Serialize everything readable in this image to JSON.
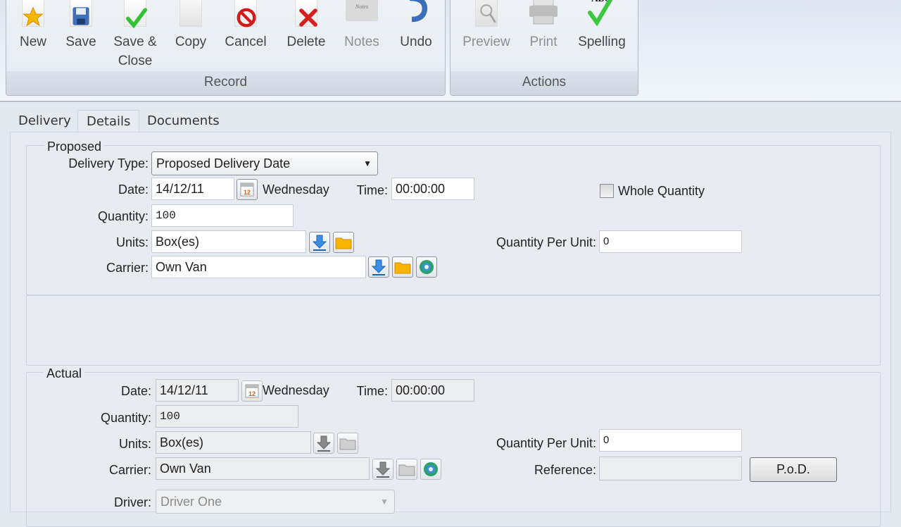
{
  "ribbon": {
    "groups": [
      {
        "label": "Record",
        "buttons": [
          {
            "label": "New",
            "icon": "new-star-icon",
            "enabled": true
          },
          {
            "label": "Save",
            "icon": "floppy-disk-icon",
            "enabled": true
          },
          {
            "label": "Save &",
            "label2": "Close",
            "icon": "save-close-check-icon",
            "enabled": true
          },
          {
            "label": "Copy",
            "icon": "copy-icon",
            "enabled": true
          },
          {
            "label": "Cancel",
            "icon": "cancel-icon",
            "enabled": true
          },
          {
            "label": "Delete",
            "icon": "delete-x-icon",
            "enabled": true
          },
          {
            "label": "Notes",
            "icon": "notes-icon",
            "enabled": false
          },
          {
            "label": "Undo",
            "icon": "undo-arrow-icon",
            "enabled": true
          }
        ]
      },
      {
        "label": "Actions",
        "buttons": [
          {
            "label": "Preview",
            "icon": "preview-magnifier-icon",
            "enabled": false
          },
          {
            "label": "Print",
            "icon": "printer-icon",
            "enabled": false
          },
          {
            "label": "Spelling",
            "icon": "spelling-abc-check-icon",
            "enabled": true
          }
        ]
      }
    ]
  },
  "tabs": [
    {
      "label": "Delivery",
      "active": false
    },
    {
      "label": "Details",
      "active": true
    },
    {
      "label": "Documents",
      "active": false
    }
  ],
  "proposed": {
    "legend": "Proposed",
    "delivery_type_label": "Delivery Type:",
    "delivery_type_value": "Proposed Delivery Date",
    "date_label": "Date:",
    "date_value": "14/12/11",
    "day_name": "Wednesday",
    "time_label": "Time:",
    "time_value": "00:00:00",
    "whole_quantity_label": "Whole Quantity",
    "whole_quantity_checked": false,
    "quantity_label": "Quantity:",
    "quantity_value": "100",
    "units_label": "Units:",
    "units_value": "Box(es)",
    "qpu_label": "Quantity Per Unit:",
    "qpu_value": "0",
    "carrier_label": "Carrier:",
    "carrier_value": "Own Van"
  },
  "actual": {
    "legend": "Actual",
    "date_label": "Date:",
    "date_value": "14/12/11",
    "day_name": "Wednesday",
    "time_label": "Time:",
    "time_value": "00:00:00",
    "quantity_label": "Quantity:",
    "quantity_value": "100",
    "units_label": "Units:",
    "units_value": "Box(es)",
    "qpu_label": "Quantity Per Unit:",
    "qpu_value": "0",
    "carrier_label": "Carrier:",
    "carrier_value": "Own Van",
    "reference_label": "Reference:",
    "reference_value": "",
    "pod_button": "P.o.D.",
    "driver_label": "Driver:",
    "driver_value": "Driver One"
  }
}
